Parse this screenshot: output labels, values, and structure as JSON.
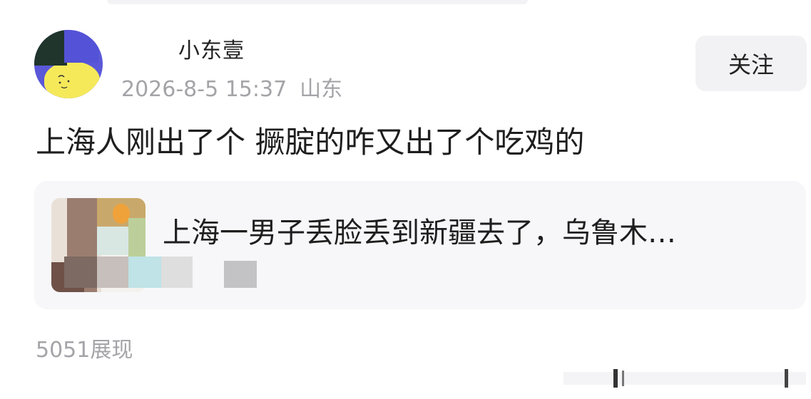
{
  "post": {
    "username": "小东壹",
    "timestamp": "2026-8-5 15:37",
    "location": "山东",
    "follow_label": "关注",
    "text": "上海人刚出了个 撅腚的咋又出了个吃鸡的",
    "link_card": {
      "title": "上海一男子丢脸丢到新疆去了，乌鲁木…"
    },
    "views": "5051展现"
  },
  "colors": {
    "accent": "#5a58d8",
    "meta_gray": "#a4a4a8",
    "card_bg": "#f7f7f9",
    "button_bg": "#f2f2f4"
  }
}
